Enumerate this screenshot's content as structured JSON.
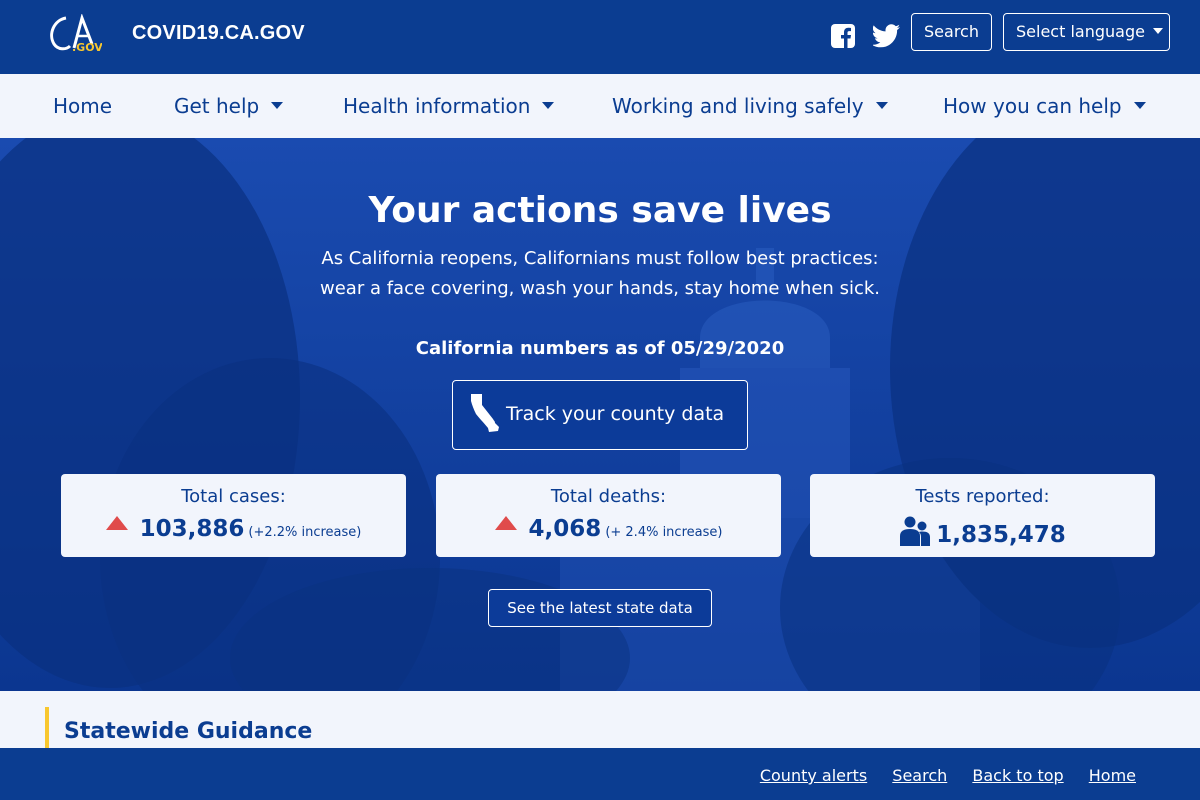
{
  "header": {
    "logo_text": "CA.GOV",
    "site_name": "COVID19.CA.GOV",
    "social": [
      {
        "icon": "facebook-icon"
      },
      {
        "icon": "twitter-icon"
      }
    ],
    "search_label": "Search",
    "language_label": "Select language"
  },
  "nav": {
    "items": [
      {
        "label": "Home",
        "has_dropdown": false
      },
      {
        "label": "Get help",
        "has_dropdown": true
      },
      {
        "label": "Health information",
        "has_dropdown": true
      },
      {
        "label": "Working and living safely",
        "has_dropdown": true
      },
      {
        "label": "How you can help",
        "has_dropdown": true
      }
    ]
  },
  "hero": {
    "title": "Your actions save lives",
    "intro_line1": "As California reopens, Californians must follow best practices:",
    "intro_line2": "wear a face covering, wash your hands, stay home when sick.",
    "numbers_as_of": "California numbers as of 05/29/2020",
    "track_button": "Track your county data",
    "latest_button": "See the latest state data"
  },
  "stats": [
    {
      "title": "Total cases:",
      "value": "103,886",
      "change": "(+2.2% increase)",
      "icon": "triangle-up-icon"
    },
    {
      "title": "Total deaths:",
      "value": "4,068",
      "change": "(+ 2.4% increase)",
      "icon": "triangle-up-icon"
    },
    {
      "title": "Tests reported:",
      "value": "1,835,478",
      "change": "",
      "icon": "people-icon"
    }
  ],
  "guidance": {
    "title": "Statewide Guidance"
  },
  "footer": {
    "links": [
      "County alerts",
      "Search",
      "Back to top",
      "Home"
    ]
  },
  "colors": {
    "primary": "#0b3d91",
    "hero_blue": "#0c3b99",
    "accent_yellow": "#f8c72f",
    "increase_red": "#e04b4b",
    "light_bg": "#f2f5fc"
  }
}
